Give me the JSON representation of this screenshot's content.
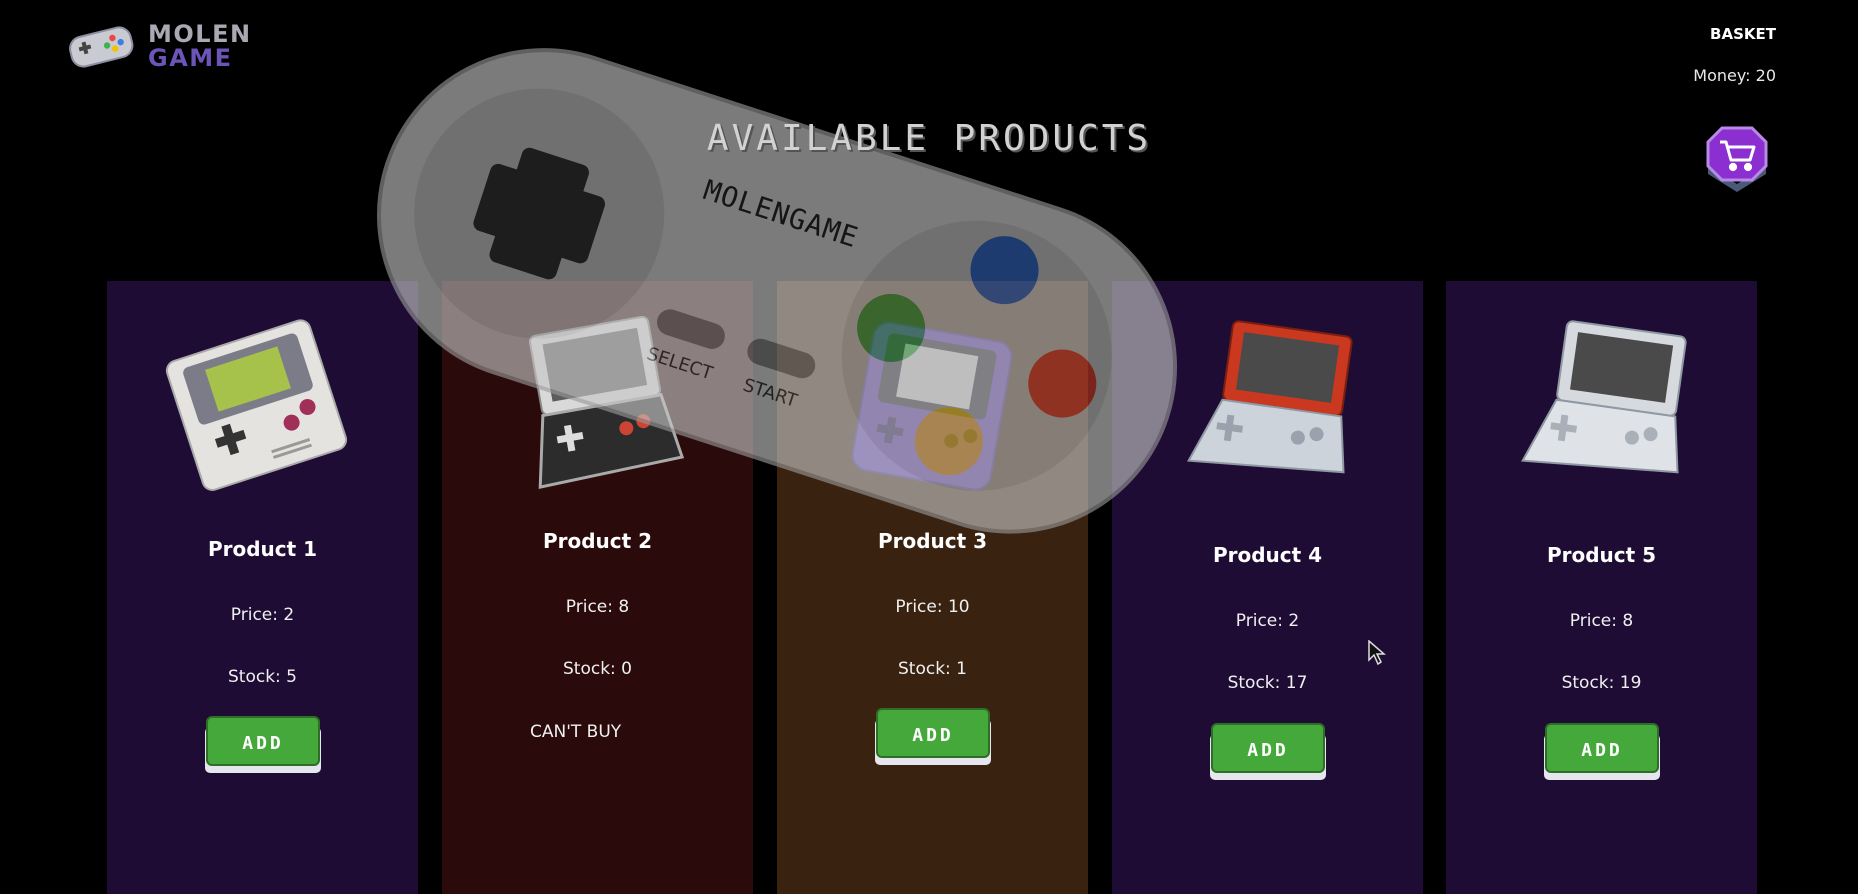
{
  "header": {
    "logo_line1": "MOLEN",
    "logo_line2": "GAME",
    "basket_label": "BASKET",
    "money_label": "Money: 20"
  },
  "page_title": "AVAILABLE PRODUCTS",
  "overlay": {
    "brand": "MOLENGAME",
    "select_label": "SELECT",
    "start_label": "START"
  },
  "products": [
    {
      "name": "Product 1",
      "price": "Price: 2",
      "stock": "Stock: 5",
      "button": "ADD",
      "image": "gameboy-classic-icon"
    },
    {
      "name": "Product 2",
      "price": "Price: 8",
      "stock": "Stock: 0",
      "status": "CAN'T BUY",
      "image": "gameboy-advance-sp-nes-icon"
    },
    {
      "name": "Product 3",
      "price": "Price: 10",
      "stock": "Stock: 1",
      "button": "ADD",
      "image": "gameboy-color-purple-icon"
    },
    {
      "name": "Product 4",
      "price": "Price: 2",
      "stock": "Stock: 17",
      "button": "ADD",
      "image": "gameboy-advance-sp-red-icon"
    },
    {
      "name": "Product 5",
      "price": "Price: 8",
      "stock": "Stock: 19",
      "button": "ADD",
      "image": "gameboy-advance-sp-silver-icon"
    }
  ],
  "colors": {
    "card_bg": "#1e0c34",
    "soldout_bg": "#2a0a0a",
    "lowstock_bg": "#3a2210",
    "add_button": "#45a83a",
    "cart_button": "#8b2fd1",
    "logo_accent": "#6b55b8"
  }
}
